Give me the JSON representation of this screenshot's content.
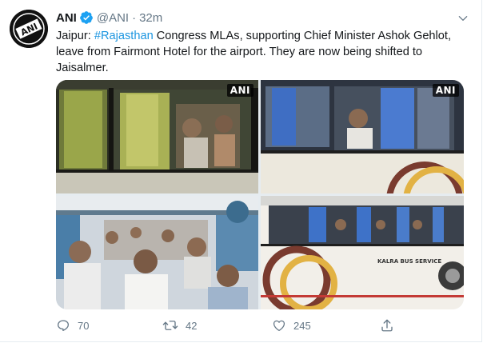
{
  "tweet": {
    "author_name": "ANI",
    "handle": "@ANI",
    "separator": "·",
    "time": "32m",
    "text_prefix": "Jaipur: ",
    "hashtag": "#Rajasthan",
    "text_body": " Congress MLAs, supporting Chief Minister Ashok Gehlot, leave from Fairmont Hotel for the airport. They are now being shifted to Jaisalmer.",
    "avatar_text": "ANI"
  },
  "media": {
    "watermark": "ANI",
    "bus_side_text": "KALRA BUS SERVICE"
  },
  "actions": {
    "reply_count": "70",
    "retweet_count": "42",
    "like_count": "245"
  },
  "icons": {
    "verified": "verified-badge-icon",
    "caret": "chevron-down-icon",
    "reply": "reply-icon",
    "retweet": "retweet-icon",
    "like": "heart-icon",
    "share": "share-icon"
  },
  "colors": {
    "accent": "#1da1f2",
    "hashtag": "#1b95e0",
    "secondary_text": "#657786",
    "primary_text": "#14171a"
  }
}
